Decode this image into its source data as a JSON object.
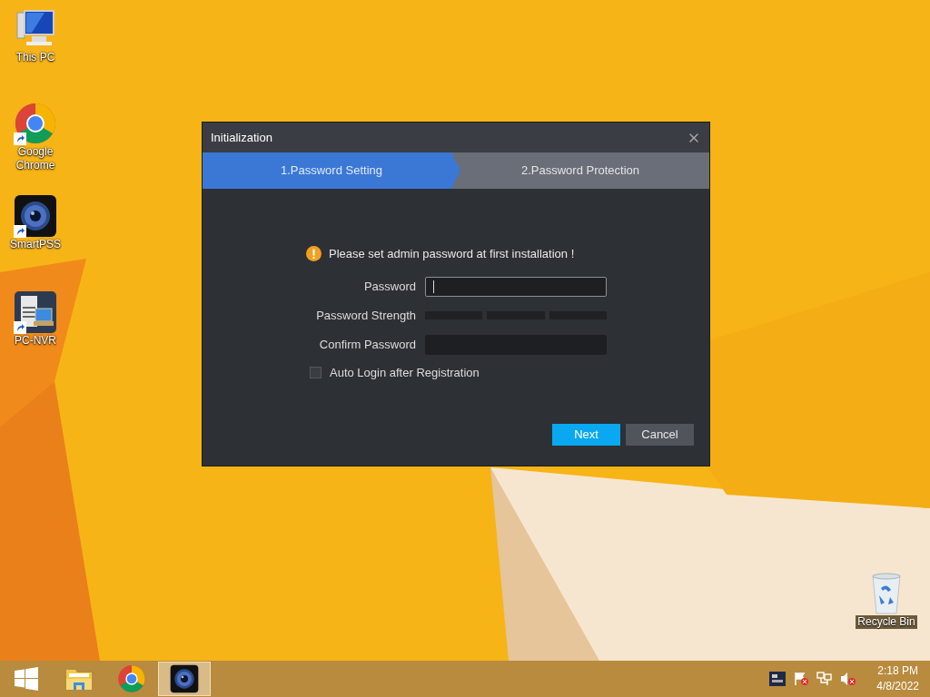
{
  "desktop_icons": [
    {
      "label": "This PC",
      "kind": "computer",
      "shortcut": false
    },
    {
      "label": "Google Chrome",
      "kind": "chrome",
      "shortcut": true
    },
    {
      "label": "SmartPSS",
      "kind": "camera",
      "shortcut": true
    },
    {
      "label": "PC-NVR",
      "kind": "nvr",
      "shortcut": true
    }
  ],
  "recycle_bin": {
    "label": "Recycle Bin"
  },
  "dialog": {
    "title": "Initialization",
    "steps": [
      {
        "label": "1.Password Setting",
        "selected": true
      },
      {
        "label": "2.Password Protection",
        "selected": false
      }
    ],
    "notice": "Please set admin password at first installation !",
    "rows": [
      {
        "kind": "input",
        "label": "Password",
        "focused": true
      },
      {
        "kind": "strength",
        "label": "Password Strength",
        "segments": [
          {
            "lit": false
          },
          {
            "lit": false
          },
          {
            "lit": false
          }
        ]
      },
      {
        "kind": "input",
        "label": "Confirm Password",
        "focused": false
      }
    ],
    "checkbox": {
      "label": "Auto Login after Registration",
      "checked": false
    },
    "buttons": [
      {
        "label": "Next",
        "kind": "primary"
      },
      {
        "label": "Cancel",
        "kind": "secondary"
      }
    ]
  },
  "taskbar": {
    "items": [
      {
        "kind": "start",
        "selected": false
      },
      {
        "kind": "explorer",
        "selected": false
      },
      {
        "kind": "chrome",
        "selected": false
      },
      {
        "kind": "camera",
        "selected": true
      }
    ],
    "tray": [
      {
        "kind": "app"
      },
      {
        "kind": "flag"
      },
      {
        "kind": "network"
      },
      {
        "kind": "volume"
      }
    ],
    "time": "2:18 PM",
    "date": "4/8/2022"
  }
}
